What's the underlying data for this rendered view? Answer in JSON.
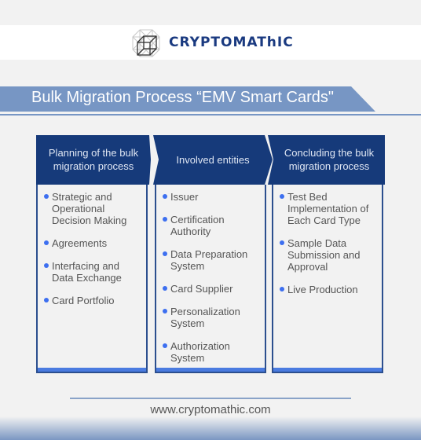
{
  "brand": {
    "name": "CRYPTOMAThIC",
    "logo_icon": "wireframe-cube-icon"
  },
  "title": "Bulk Migration Process “EMV Smart Cards\"",
  "colors": {
    "header_navy": "#163a7a",
    "banner_blue": "#7796c4",
    "bullet_blue": "#3d6ff0",
    "background": "#f2f2f2"
  },
  "columns": [
    {
      "heading": "Planning of the bulk migration process",
      "items": [
        "Strategic and Operational Decision Making",
        "Agreements",
        "Interfacing and Data Exchange",
        "Card Portfolio"
      ]
    },
    {
      "heading": "Involved entities",
      "items": [
        "Issuer",
        "Certification Authority",
        "Data Preparation System",
        "Card Supplier",
        "Personalization System",
        "Authorization System"
      ]
    },
    {
      "heading": "Concluding the bulk migration process",
      "items": [
        "Test Bed Implementation of Each Card Type",
        "Sample Data Submission and Approval",
        "Live Production"
      ]
    }
  ],
  "footer": {
    "url": "www.cryptomathic.com"
  }
}
